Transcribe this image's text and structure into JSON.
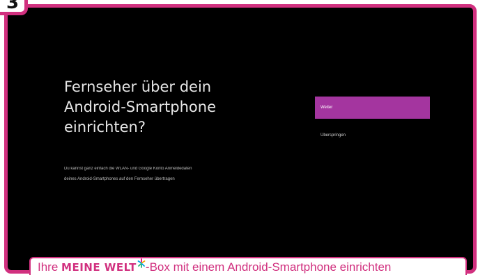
{
  "step": {
    "number": "3"
  },
  "tv_screen": {
    "title_lines": [
      "Fernseher über dein",
      "Android-Smartphone",
      "einrichten?"
    ],
    "description_lines": [
      "Du kannst ganz einfach die WLAN- und Google Konto Anmeldedaten",
      "deines Android-Smartphones auf den Fernseher übertragen"
    ],
    "menu": [
      {
        "label": "Weiter",
        "selected": true
      },
      {
        "label": "Überspringen",
        "selected": false
      }
    ]
  },
  "caption": {
    "prefix": "Ihre ",
    "brand": "MEINE WELT",
    "logo_icon": "sparkle-logo-icon",
    "suffix": "-Box mit einem Android-Smartphone einrichten"
  },
  "colors": {
    "accent": "#d1307f",
    "selection": "#a4359f",
    "screen_background": "#000000",
    "logo": [
      "#e6007e",
      "#2bb673",
      "#00a0e3",
      "#f7a600"
    ]
  }
}
